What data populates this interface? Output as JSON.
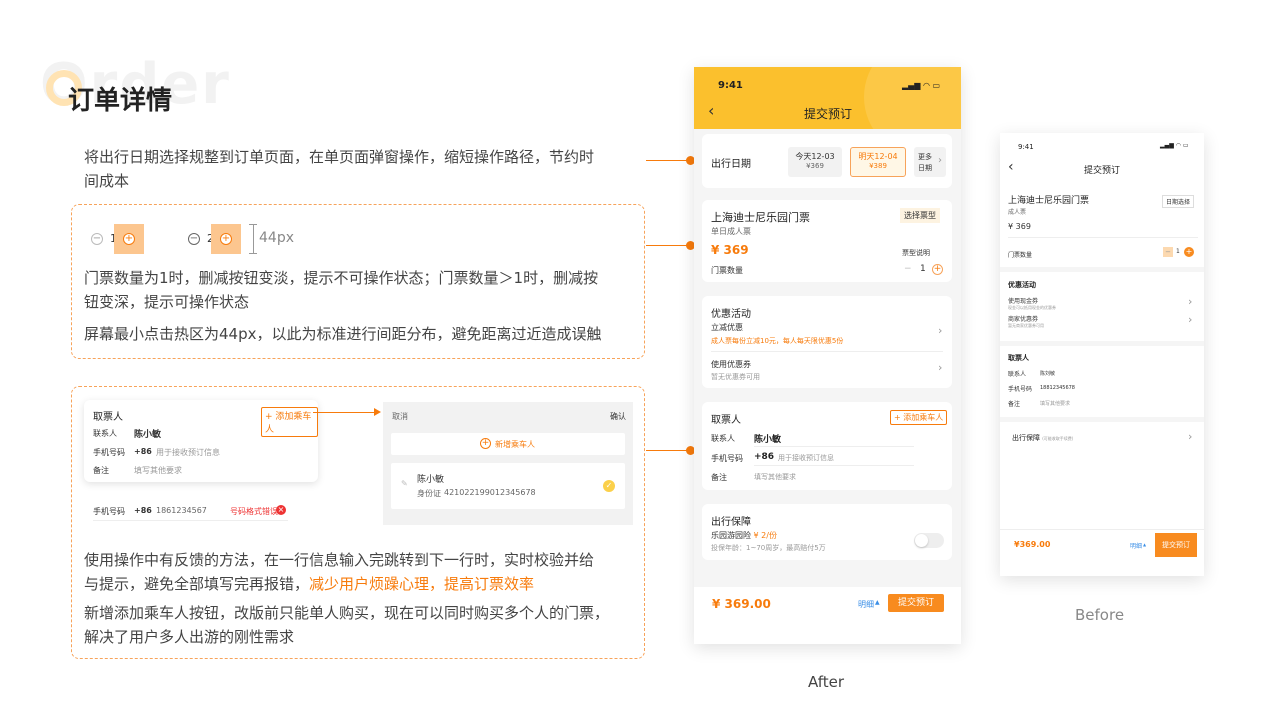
{
  "header": {
    "title": "订单详情",
    "bg_word": "Order"
  },
  "section1": {
    "desc": "将出行日期选择规整到订单页面，在单页面弹窗操作，缩短操作路径，节约时间成本",
    "desc_line1": "将出行日期选择规整到订单页面，在单页面弹窗操作，缩短操作路径，节约时",
    "desc_line2": "间成本"
  },
  "section2": {
    "qty1": "1",
    "qty2": "2",
    "size_label": "44px",
    "text1_line1": "门票数量为1时，删减按钮变淡，提示不可操作状态；门票数量＞1时，删减按",
    "text1_line2": "钮变深，提示可操作状态",
    "text2": "屏幕最小点击热区为44px，以此为标准进行间距分布，避免距离过近造成误触"
  },
  "section3": {
    "card": {
      "title": "取票人",
      "add_button": "+ 添加乘车人",
      "contact_label": "联系人",
      "contact_value": "陈小敏",
      "phone_label": "手机号码",
      "phone_code": "+86",
      "phone_placeholder": "用于接收预订信息",
      "note_label": "备注",
      "note_placeholder": "填写其他要求"
    },
    "error_row": {
      "label": "手机号码",
      "code": "+86",
      "value": "1861234567",
      "error": "号码格式错误"
    },
    "popup": {
      "cancel": "取消",
      "confirm": "确认",
      "add_passenger": "新增乘车人",
      "passenger_name": "陈小敏",
      "id_label": "身份证",
      "id_value": "421022199012345678"
    },
    "text1_line1": "使用操作中有反馈的方法，在一行信息输入完跳转到下一行时，实时校验并给",
    "text1_line2_a": "与提示，避免全部填写完再报错，",
    "text1_line2_b": "减少用户烦躁心理，提高订票效率",
    "text2_line1": "新增添加乘车人按钮，改版前只能单人购买，现在可以同时购买多个人的门票，",
    "text2_line2": "解决了用户多人出游的刚性需求"
  },
  "after": {
    "caption": "After",
    "time": "9:41",
    "nav_title": "提交预订",
    "date_label": "出行日期",
    "today": "今天12-03",
    "today_price": "¥369",
    "tomorrow": "明天12-04",
    "tomorrow_price": "¥389",
    "more": "更多",
    "more2": "日期",
    "product_title": "上海迪士尼乐园门票",
    "ticket_type_btn": "选择票型",
    "product_sub": "单日成人票",
    "price": "¥ 369",
    "ticket_note": "票型说明",
    "qty_label": "门票数量",
    "qty": "1",
    "promo_title": "优惠活动",
    "promo1": "立减优惠",
    "promo1_sub": "成人票每份立减10元，每人每天限优惠5份",
    "promo2": "使用优惠券",
    "promo2_sub": "暂无优惠券可用",
    "taker_title": "取票人",
    "add_btn": "+ 添加乘车人",
    "contact_label": "联系人",
    "contact_value": "陈小敏",
    "phone_label": "手机号码",
    "phone_code": "+86",
    "phone_placeholder": "用于接收预订信息",
    "note_label": "备注",
    "note_placeholder": "填写其他要求",
    "insurance_title": "出行保障",
    "insurance_name": "乐园游园险",
    "insurance_price": "¥ 2/份",
    "insurance_sub": "投保年龄：1~70周岁，最高赔付5万",
    "total": "¥ 369.00",
    "detail": "明细",
    "submit": "提交预订"
  },
  "before": {
    "caption": "Before",
    "time": "9:41",
    "nav_title": "提交预订",
    "product_title": "上海迪士尼乐园门票",
    "product_sub": "成人票",
    "date_btn": "日期选择",
    "price": "¥ 369",
    "qty_label": "门票数量",
    "qty": "1",
    "promo_title": "优惠活动",
    "promo1": "使用现金券",
    "promo1_sub": "现金可以抵用现金的优惠券",
    "promo2": "商家优惠券",
    "promo2_sub": "暂无商家优惠券可用",
    "taker_title": "取票人",
    "contact_label": "联系人",
    "contact_value": "陈刘敏",
    "phone_label": "手机号码",
    "phone_value": "18812345678",
    "note_label": "备注",
    "note_value": "填写其他要求",
    "insurance_title": "出行保障",
    "insurance_sub": "(可能收取手续费)",
    "total": "¥369.00",
    "detail": "明细",
    "submit": "提交预订"
  },
  "colors": {
    "accent": "#f77b0c",
    "yellow": "#fbc02d"
  }
}
